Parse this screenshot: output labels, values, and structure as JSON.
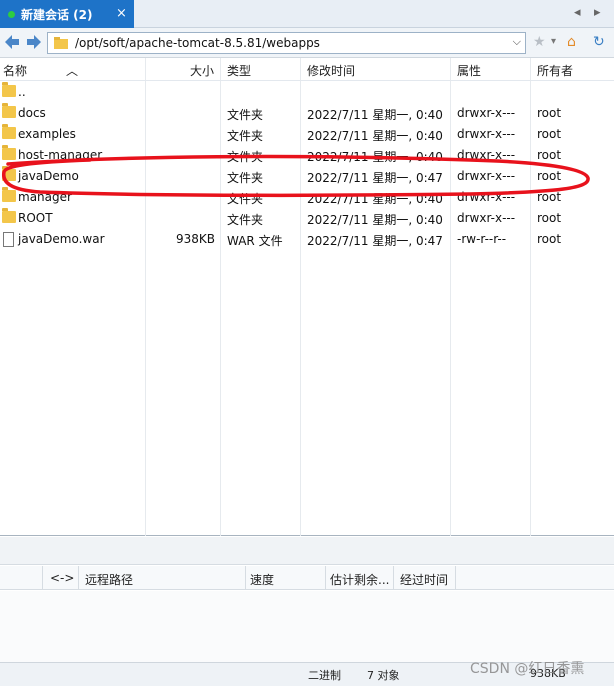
{
  "tab": {
    "title": "新建会话 (2)",
    "close_glyph": "×",
    "prev_glyph": "◂",
    "next_glyph": "▸"
  },
  "address": {
    "path": "/opt/soft/apache-tomcat-8.5.81/webapps",
    "dropdown_glyph": "⌵"
  },
  "toolbar": {
    "star_glyph": "★",
    "star_dd": "▾",
    "home_glyph": "⌂",
    "refresh_glyph": "↻"
  },
  "columns": {
    "name": "名称",
    "size": "大小",
    "type": "类型",
    "modified": "修改时间",
    "attributes": "属性",
    "owner": "所有者"
  },
  "rows": [
    {
      "name": "..",
      "size": "",
      "type": "",
      "modified": "",
      "attr": "",
      "owner": "",
      "kind": "folder"
    },
    {
      "name": "docs",
      "size": "",
      "type": "文件夹",
      "modified": "2022/7/11 星期一, 0:40",
      "attr": "drwxr-x---",
      "owner": "root",
      "kind": "folder"
    },
    {
      "name": "examples",
      "size": "",
      "type": "文件夹",
      "modified": "2022/7/11 星期一, 0:40",
      "attr": "drwxr-x---",
      "owner": "root",
      "kind": "folder"
    },
    {
      "name": "host-manager",
      "size": "",
      "type": "文件夹",
      "modified": "2022/7/11 星期一, 0:40",
      "attr": "drwxr-x---",
      "owner": "root",
      "kind": "folder"
    },
    {
      "name": "javaDemo",
      "size": "",
      "type": "文件夹",
      "modified": "2022/7/11 星期一, 0:47",
      "attr": "drwxr-x---",
      "owner": "root",
      "kind": "folder"
    },
    {
      "name": "manager",
      "size": "",
      "type": "文件夹",
      "modified": "2022/7/11 星期一, 0:40",
      "attr": "drwxr-x---",
      "owner": "root",
      "kind": "folder"
    },
    {
      "name": "ROOT",
      "size": "",
      "type": "文件夹",
      "modified": "2022/7/11 星期一, 0:40",
      "attr": "drwxr-x---",
      "owner": "root",
      "kind": "folder"
    },
    {
      "name": "javaDemo.war",
      "size": "938KB",
      "type": "WAR 文件",
      "modified": "2022/7/11 星期一, 0:47",
      "attr": "-rw-r--r--",
      "owner": "root",
      "kind": "file"
    }
  ],
  "transfer": {
    "direction": "<->",
    "remote_path": "远程路径",
    "speed": "速度",
    "eta": "估计剩余...",
    "elapsed": "经过时间"
  },
  "status": {
    "mode": "二进制",
    "count": "7 对象",
    "size": "938KB"
  },
  "watermark": "CSDN @红日香熏",
  "colors": {
    "tab_active": "#1e73c8",
    "annotation_red": "#e8121c",
    "folder": "#f3c64a"
  }
}
